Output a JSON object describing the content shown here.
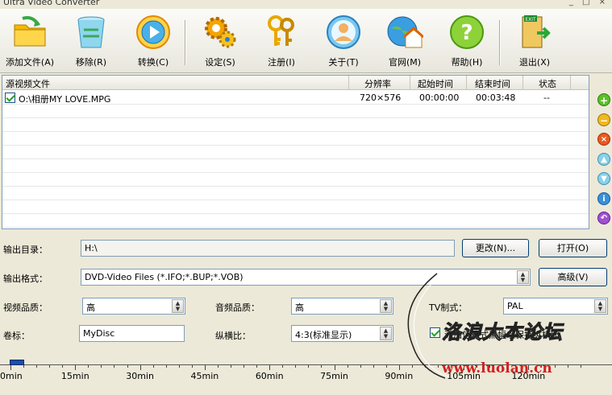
{
  "window": {
    "title": "Ultra Video Converter",
    "controls": "_ □ ×"
  },
  "toolbar": {
    "add": "添加文件(A)",
    "remove": "移除(R)",
    "convert": "转换(C)",
    "settings": "设定(S)",
    "register": "注册(I)",
    "about": "关于(T)",
    "website": "官网(M)",
    "help": "帮助(H)",
    "exit": "退出(X)"
  },
  "filelist": {
    "columns": [
      "源视频文件",
      "分辨率",
      "起始时间",
      "结束时间",
      "状态"
    ],
    "rows": [
      {
        "checked": true,
        "file": "O:\\相册MY LOVE.MPG",
        "resolution": "720×576",
        "start": "00:00:00",
        "end": "00:03:48",
        "status": "--"
      }
    ]
  },
  "side_icons": [
    "add-icon",
    "minus-icon",
    "remove-icon",
    "up-icon",
    "down-icon",
    "info-icon",
    "back-icon"
  ],
  "form": {
    "output_dir_label": "输出目录：",
    "output_dir_value": "H:\\",
    "change_button": "更改(N)...",
    "open_button": "打开(O)",
    "output_format_label": "输出格式：",
    "output_format_value": "DVD-Video Files  (*.IFO;*.BUP;*.VOB)",
    "advanced_button": "高级(V)",
    "video_quality_label": "视频品质：",
    "video_quality_value": "高",
    "audio_quality_label": "音频品质：",
    "audio_quality_value": "高",
    "tv_label": "TV制式：",
    "tv_value": "PAL",
    "volume_label": "卷标：",
    "volume_value": "MyDisc",
    "aspect_label": "纵横比：",
    "aspect_value": "4:3(标准显示)",
    "letterbox_label": "添加信箱式黑幅以保持纵横比",
    "letterbox_checked": true
  },
  "timeline": {
    "labels": [
      "0min",
      "15min",
      "30min",
      "45min",
      "60min",
      "75min",
      "90min",
      "105min",
      "120min"
    ]
  },
  "watermark": {
    "text": "洛浪大本论坛",
    "url": "www.luolan.cn"
  }
}
